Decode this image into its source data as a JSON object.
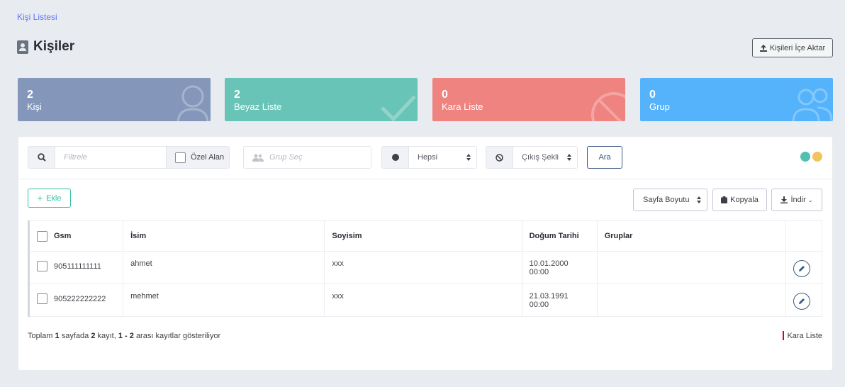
{
  "breadcrumb": "Kişi Listesi",
  "page_title": "Kişiler",
  "import_button": "Kişileri İçe Aktar",
  "stats": [
    {
      "value": "2",
      "label": "Kişi",
      "color": "#8497ba"
    },
    {
      "value": "2",
      "label": "Beyaz Liste",
      "color": "#68c4b6"
    },
    {
      "value": "0",
      "label": "Kara Liste",
      "color": "#ef8380"
    },
    {
      "value": "0",
      "label": "Grup",
      "color": "#55b3fb"
    }
  ],
  "filters": {
    "search_placeholder": "Filtrele",
    "custom_field_label": "Özel Alan",
    "group_placeholder": "Grup Seç",
    "status_value": "Hepsi",
    "exit_value": "Çıkış Şekli",
    "search_button": "Ara",
    "dot_colors": [
      "#4fc0b2",
      "#f2c55c"
    ]
  },
  "toolbar": {
    "add": "Ekle",
    "page_size": "Sayfa Boyutu",
    "copy": "Kopyala",
    "download": "İndir"
  },
  "table": {
    "headers": {
      "gsm": "Gsm",
      "name": "İsim",
      "surname": "Soyisim",
      "birth": "Doğum Tarihi",
      "groups": "Gruplar"
    },
    "rows": [
      {
        "gsm": "905111111111",
        "name": "ahmet",
        "surname": "xxx",
        "birth": "10.01.2000 00:00",
        "groups": ""
      },
      {
        "gsm": "905222222222",
        "name": "mehmet",
        "surname": "xxx",
        "birth": "21.03.1991 00:00",
        "groups": ""
      }
    ]
  },
  "footer": {
    "prefix": "Toplam",
    "pages": "1",
    "mid1": "sayfada",
    "records": "2",
    "mid2": "kayıt,",
    "range": "1 - 2",
    "suffix": "arası kayıtlar gösteriliyor",
    "legend": "Kara Liste"
  }
}
